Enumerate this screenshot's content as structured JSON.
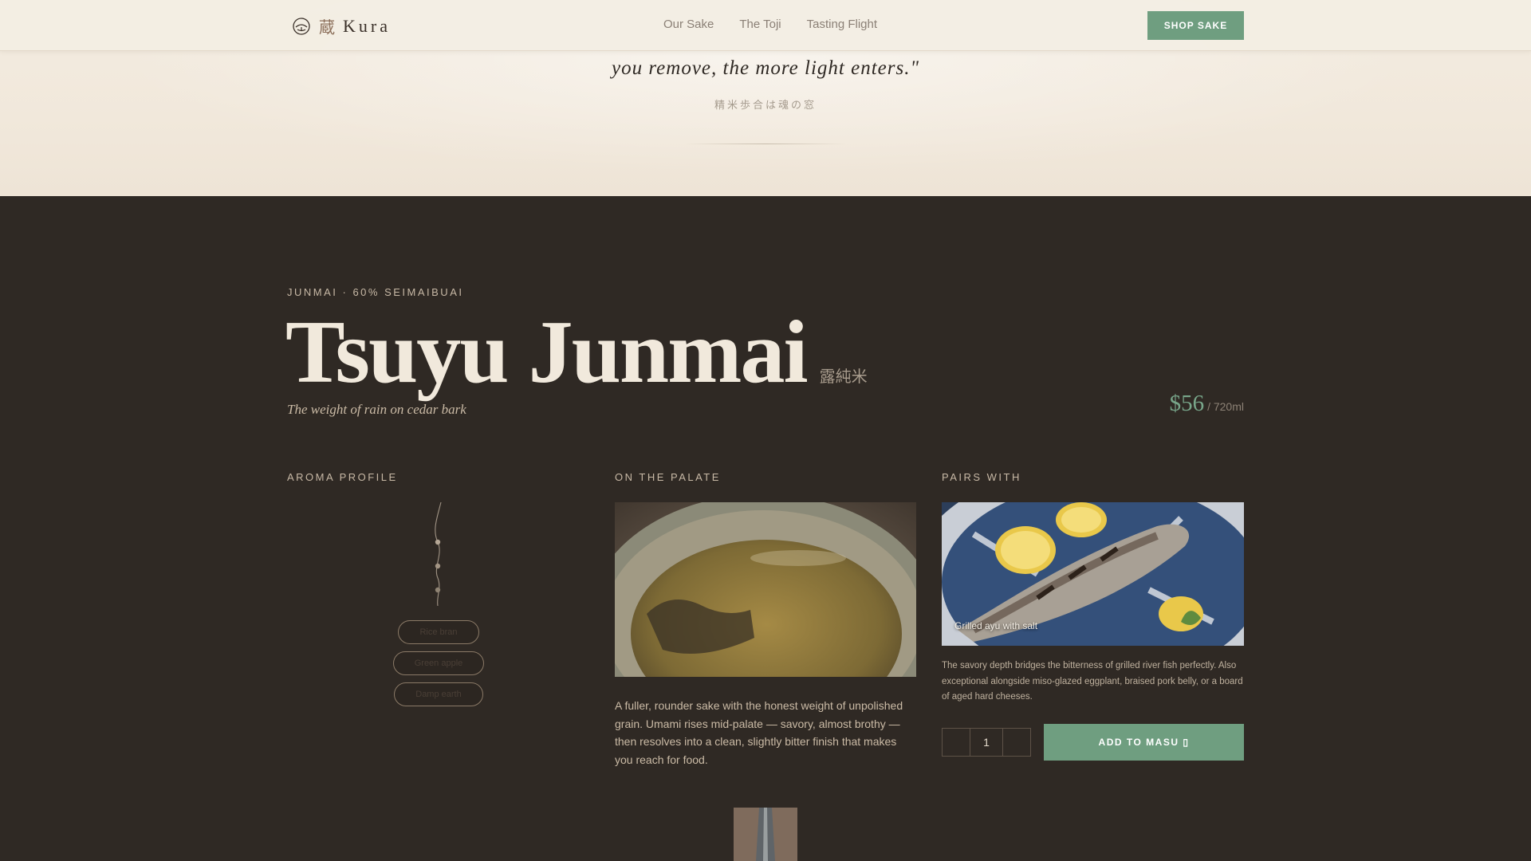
{
  "header": {
    "brand_kanji": "蔵",
    "brand_name": "Kura",
    "nav": [
      "Our Sake",
      "The Toji",
      "Tasting Flight"
    ],
    "shop_label": "SHOP SAKE"
  },
  "quote": {
    "line": "you remove, the more light enters.\"",
    "japanese": "精米歩合は魂の窓"
  },
  "product": {
    "kicker": "JUNMAI · 60% SEIMAIBUAI",
    "title": "Tsuyu Junmai",
    "title_jp": "露純米",
    "tagline": "The weight of rain on cedar bark",
    "price": "$56",
    "price_unit": "/ 720ml"
  },
  "aroma": {
    "label": "AROMA PROFILE",
    "tags": [
      "Rice bran",
      "Green apple",
      "Damp earth"
    ]
  },
  "palate": {
    "label": "ON THE PALATE",
    "text": "A fuller, rounder sake with the honest weight of unpolished grain. Umami rises mid-palate — savory, almost brothy — then resolves into a clean, slightly bitter finish that makes you reach for food."
  },
  "pairs": {
    "label": "PAIRS WITH",
    "caption": "Grilled ayu with salt",
    "text": "The savory depth bridges the bitterness of grilled river fish perfectly. Also exceptional alongside miso-glazed eggplant, braised pork belly, or a board of aged hard cheeses."
  },
  "cart": {
    "quantity": "1",
    "add_label": "ADD TO MASU ▯"
  },
  "colors": {
    "accent": "#6f9e80",
    "dark_bg": "#2f2924",
    "light_bg": "#f3ece1"
  }
}
